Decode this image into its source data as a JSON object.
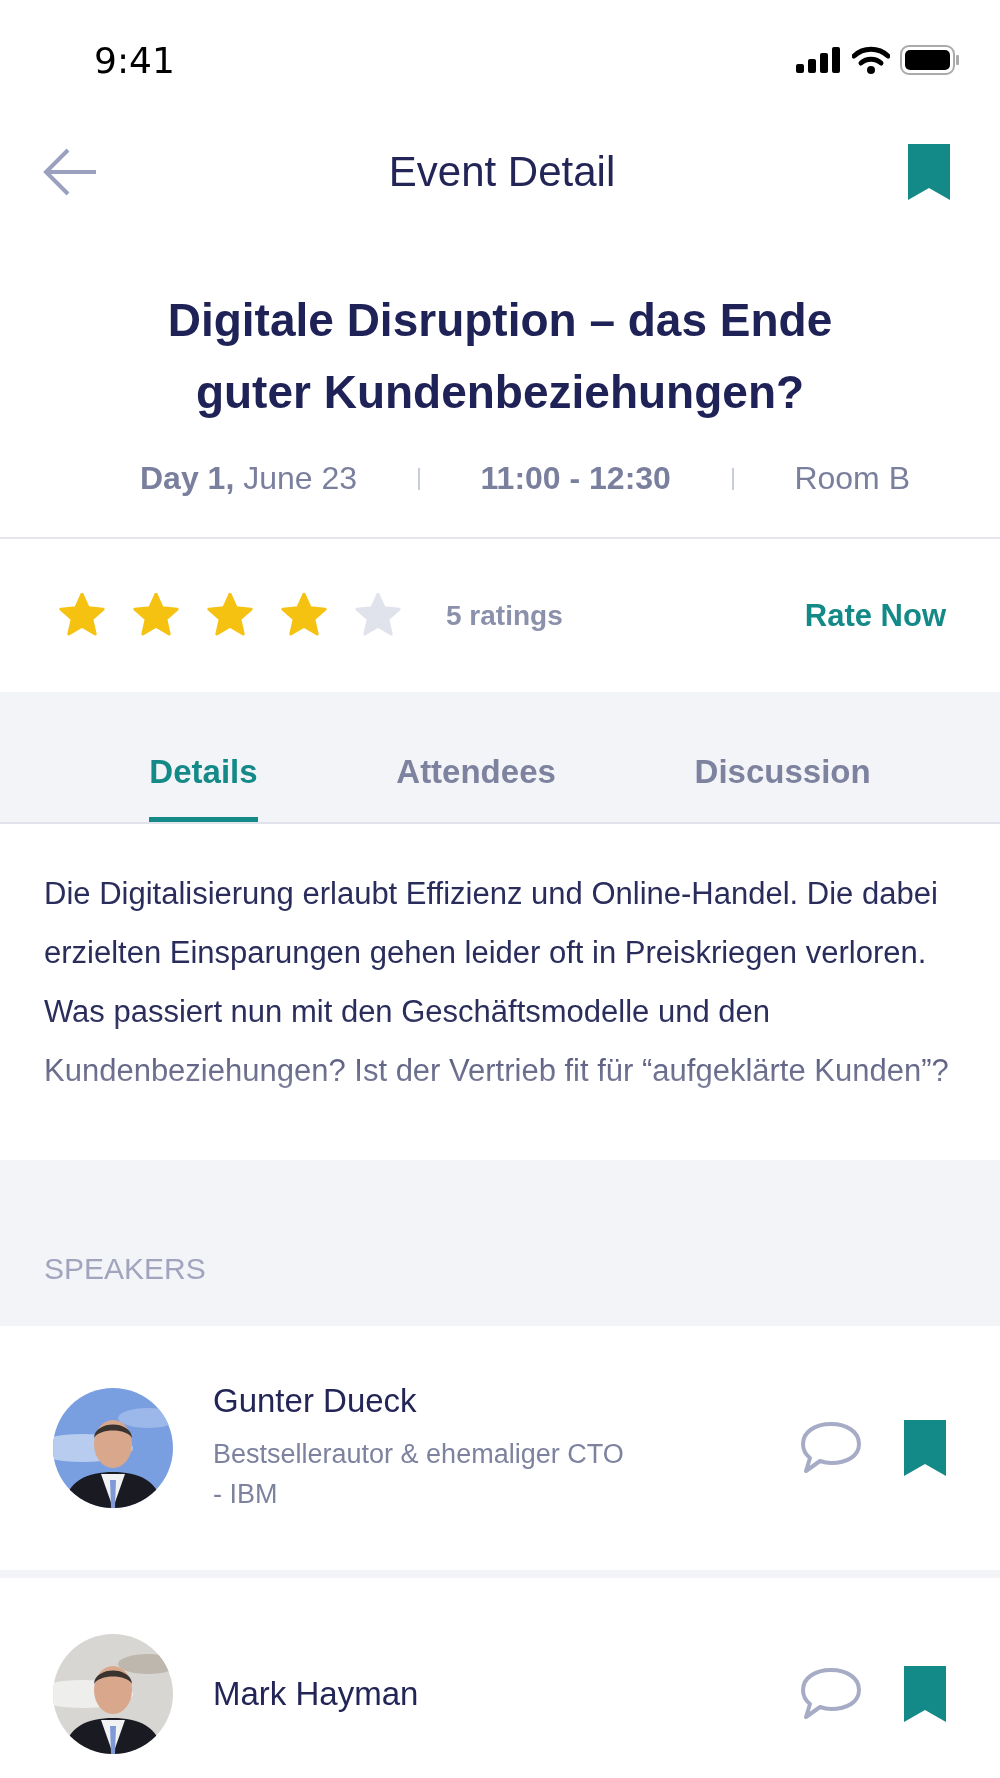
{
  "status_bar": {
    "time": "9:41"
  },
  "header": {
    "title": "Event Detail",
    "bookmarked": true
  },
  "event": {
    "title": "Digitale Disruption – das Ende guter Kundenbeziehungen?",
    "date": "**Day 1,** June 23",
    "time": "11:00 - 12:30",
    "room": "Room B"
  },
  "rating": {
    "stars": 4,
    "count": "5 ratings",
    "action": "Rate Now"
  },
  "tabs": [
    {
      "label": "Details",
      "selected": true
    },
    {
      "label": "Attendees",
      "selected": false
    },
    {
      "label": "Discussion",
      "selected": false
    }
  ],
  "description": "Die Digitalisierung erlaubt Effizienz und Online-Handel. Die dabei erzielten Einsparungen gehen leider oft in Preiskriegen verloren. Was passiert nun mit den Geschäftsmodelle und den Kundenbeziehungen? Ist der Vertrieb fit für “aufgeklärte Kunden”?",
  "speakers": {
    "heading": "SPEAKERS",
    "items": [
      {
        "name": "Gunter Dueck",
        "title": "Bestsellerautor & ehemaliger CTO - IBM",
        "bookmarked": true
      },
      {
        "name": "Mark Hayman",
        "bookmarked": true
      }
    ]
  }
}
